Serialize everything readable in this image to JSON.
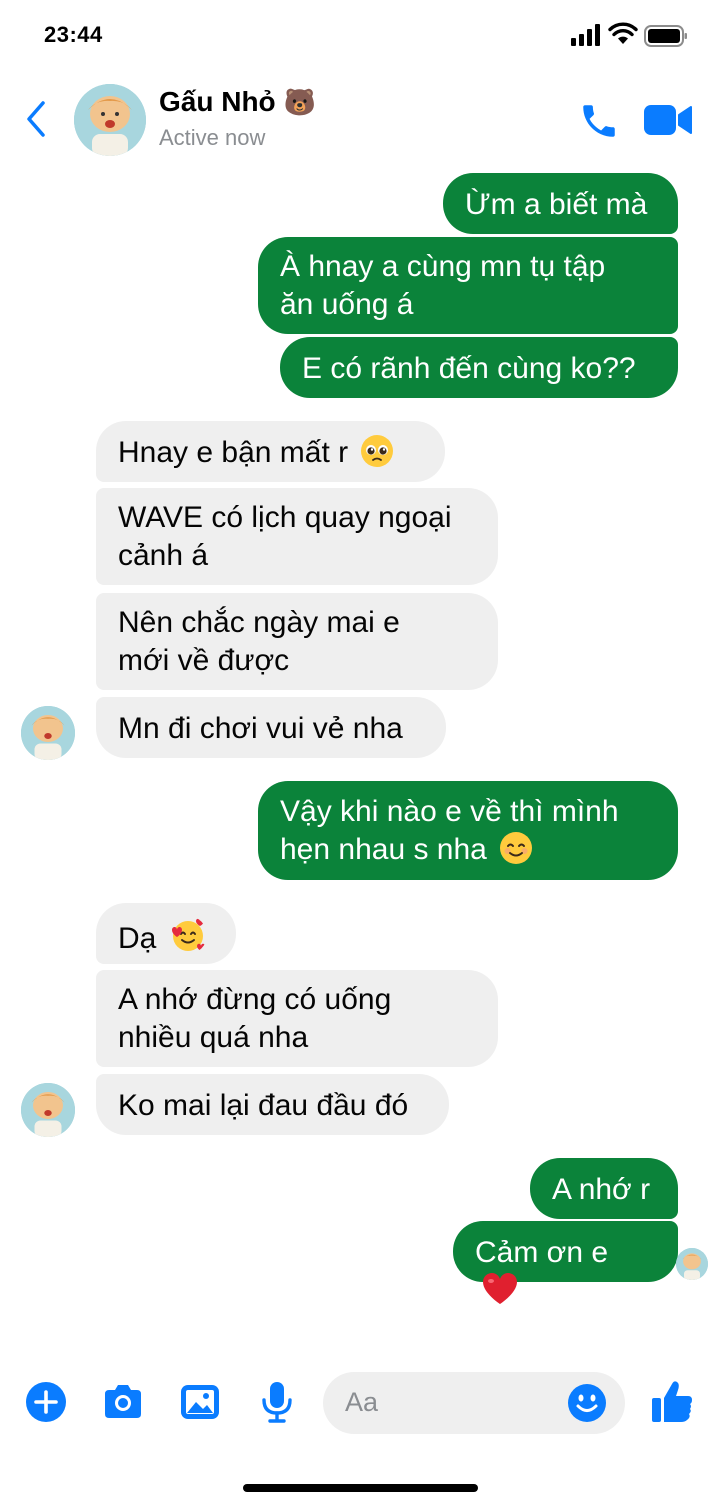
{
  "status_bar": {
    "time": "23:44"
  },
  "header": {
    "name": "Gấu Nhỏ",
    "name_emoji": "🐻",
    "status": "Active now"
  },
  "colors": {
    "accent": "#0a7cff",
    "outgoing_bubble": "#0b833a",
    "incoming_bubble": "#efefef"
  },
  "messages": [
    {
      "dir": "out",
      "text": "Ừm a biết mà"
    },
    {
      "dir": "out",
      "text_lines": [
        "À hnay a cùng mn tụ tập",
        "ăn uống á"
      ]
    },
    {
      "dir": "out",
      "text": "E có rãnh đến cùng ko??"
    },
    {
      "dir": "in",
      "text": "Hnay e bận mất r",
      "emoji": "pleading-face"
    },
    {
      "dir": "in",
      "text_lines": [
        "WAVE có lịch quay ngoại",
        "cảnh á"
      ]
    },
    {
      "dir": "in",
      "text_lines": [
        "Nên chắc ngày mai e",
        "mới về được"
      ]
    },
    {
      "dir": "in",
      "text": "Mn đi chơi vui vẻ nha"
    },
    {
      "dir": "out",
      "text_lines": [
        "Vậy khi nào e về thì mình",
        "hẹn nhau s nha"
      ],
      "emoji": "smiling-face"
    },
    {
      "dir": "in",
      "text": "Dạ",
      "emoji": "smiling-face-with-hearts"
    },
    {
      "dir": "in",
      "text_lines": [
        "A nhớ đừng có uống",
        "nhiều quá nha"
      ]
    },
    {
      "dir": "in",
      "text": "Ko mai lại đau đầu đó"
    },
    {
      "dir": "out",
      "text": "A nhớ r"
    },
    {
      "dir": "out",
      "text": "Cảm ơn e",
      "emoji": "red-heart"
    }
  ],
  "composer": {
    "placeholder": "Aa"
  },
  "icons": [
    "back-chevron-icon",
    "phone-icon",
    "video-camera-icon",
    "plus-icon",
    "camera-icon",
    "image-icon",
    "microphone-icon",
    "emoji-icon",
    "thumbs-up-icon"
  ]
}
